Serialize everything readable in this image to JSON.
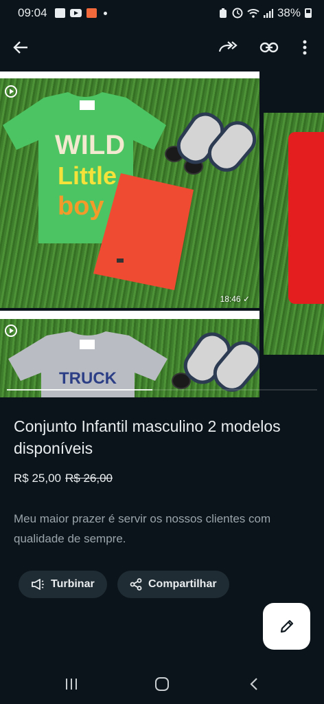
{
  "status_bar": {
    "time": "09:04",
    "battery": "38%",
    "icons": [
      "gallery-icon",
      "youtube-icon",
      "shop-app-icon",
      "notification-dot",
      "alarm-icon",
      "clock-icon",
      "wifi-icon",
      "signal-icon",
      "battery-icon"
    ]
  },
  "toolbar": {
    "icons": [
      "back-arrow-icon",
      "forward-icon",
      "link-icon",
      "more-vert-icon"
    ]
  },
  "gallery": {
    "timestamp": "18:46 ✓",
    "shirt_text_line1": "WILD",
    "shirt_text_line2": "Little",
    "shirt_text_line3": "boy",
    "shirt2_text": "TRUCK",
    "scroll_progress": 0.47
  },
  "product": {
    "title": "Conjunto Infantil masculino 2 modelos disponíveis",
    "price": "R$ 25,00",
    "original_price": "R$ 26,00",
    "description": "Meu maior prazer é servir os nossos clientes com qualidade de sempre."
  },
  "actions": {
    "boost_label": "Turbinar",
    "share_label": "Compartilhar",
    "edit_icon": "pencil-icon"
  },
  "colors": {
    "background": "#0b141a",
    "chip_bg": "#202c33",
    "text_primary": "#e9edef",
    "text_secondary": "#9aa4ab"
  }
}
